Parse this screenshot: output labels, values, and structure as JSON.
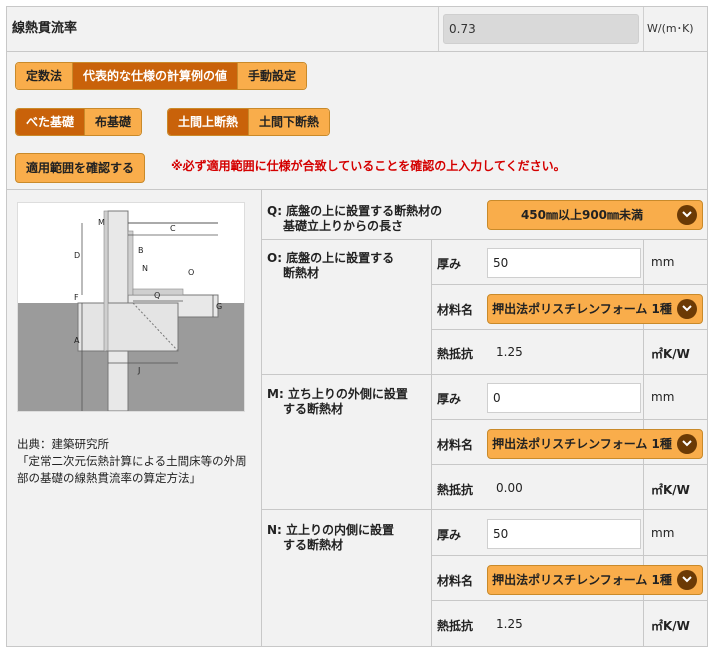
{
  "header": {
    "label": "線熱貫流率",
    "value": "0.73",
    "unit": "W/(m･K)"
  },
  "method_tabs": [
    {
      "label": "定数法",
      "active": false
    },
    {
      "label": "代表的な仕様の計算例の値",
      "active": true
    },
    {
      "label": "手動設定",
      "active": false
    }
  ],
  "foundation_tabs": [
    {
      "label": "べた基礎",
      "active": true
    },
    {
      "label": "布基礎",
      "active": false
    }
  ],
  "insulation_tabs": [
    {
      "label": "土間上断熱",
      "active": true
    },
    {
      "label": "土間下断熱",
      "active": false
    }
  ],
  "check_button": "適用範囲を確認する",
  "warning": "※必ず適用範囲に仕様が合致していることを確認の上入力してください。",
  "source": {
    "line1": "出典：建築研究所",
    "line2": "「定常二次元伝熱計算による土間床等の外周部の基礎の線熱貫流率の算定方法」"
  },
  "diagram_labels": [
    "M",
    "C",
    "D",
    "B",
    "N",
    "O",
    "Q",
    "G",
    "F",
    "A",
    "J"
  ],
  "colors": {
    "accent_active": "#c9620a",
    "accent_idle": "#f9ad4b",
    "warning": "#d40000",
    "chevron": "#6b3a05"
  },
  "q_row": {
    "title_line1": "Q: 底盤の上に設置する断熱材の",
    "title_line2": "基礎立上りからの長さ",
    "select": "450㎜以上900㎜未満"
  },
  "groups": [
    {
      "title_line1": "O: 底盤の上に設置する",
      "title_line2": "断熱材",
      "thickness_label": "厚み",
      "thickness_value": "50",
      "thickness_unit": "mm",
      "material_label": "材料名",
      "material_value": "押出法ポリスチレンフォーム 1種",
      "resistance_label": "熱抵抗",
      "resistance_value": "1.25",
      "resistance_unit": "㎡K/W"
    },
    {
      "title_line1": "M: 立ち上りの外側に設置",
      "title_line2": "する断熱材",
      "thickness_label": "厚み",
      "thickness_value": "0",
      "thickness_unit": "mm",
      "material_label": "材料名",
      "material_value": "押出法ポリスチレンフォーム 1種",
      "resistance_label": "熱抵抗",
      "resistance_value": "0.00",
      "resistance_unit": "㎡K/W"
    },
    {
      "title_line1": "N: 立上りの内側に設置",
      "title_line2": "する断熱材",
      "thickness_label": "厚み",
      "thickness_value": "50",
      "thickness_unit": "mm",
      "material_label": "材料名",
      "material_value": "押出法ポリスチレンフォーム 1種",
      "resistance_label": "熱抵抗",
      "resistance_value": "1.25",
      "resistance_unit": "㎡K/W"
    }
  ]
}
